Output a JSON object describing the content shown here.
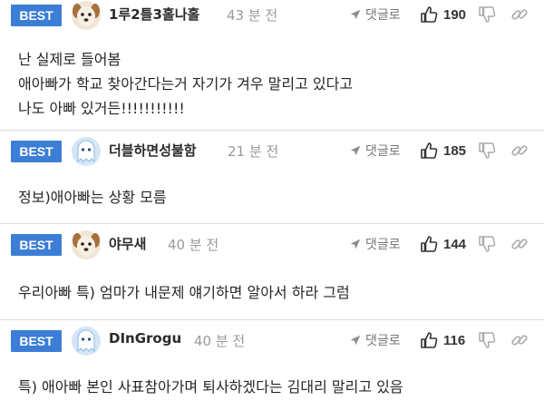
{
  "reply_label": "댓글로",
  "badge_label": "BEST",
  "comments": [
    {
      "nickname": "1루2틀3홀나홀",
      "time": "43 분 전",
      "likes": "190",
      "lines": [
        "난 실제로 들어봄",
        "애아빠가 학교 찾아간다는거 자기가 겨우 말리고 있다고",
        "나도 아빠 있거든!!!!!!!!!!!"
      ]
    },
    {
      "nickname": "더블하면성불함",
      "time": "21 분 전",
      "likes": "185",
      "lines": [
        "정보)애아빠는 상황 모름"
      ]
    },
    {
      "nickname": "야무새",
      "time": "40 분 전",
      "likes": "144",
      "lines": [
        "우리아빠 특) 엄마가 내문제 얘기하면 알아서 하라 그럼"
      ]
    },
    {
      "nickname": "DInGrogu",
      "time": "40 분 전",
      "likes": "116",
      "lines": [
        "특) 애아빠 본인 사표참아가며 퇴사하겠다는 김대리 말리고 있음"
      ]
    }
  ],
  "colors": {
    "badge": "#3c7ed6",
    "divider": "#dcdcdc",
    "muted": "#9a9a9a"
  },
  "icons": [
    "dog-avatar-icon",
    "ghost-avatar-icon",
    "send-arrow-icon",
    "thumbs-up-icon",
    "thumbs-down-icon",
    "link-icon"
  ]
}
